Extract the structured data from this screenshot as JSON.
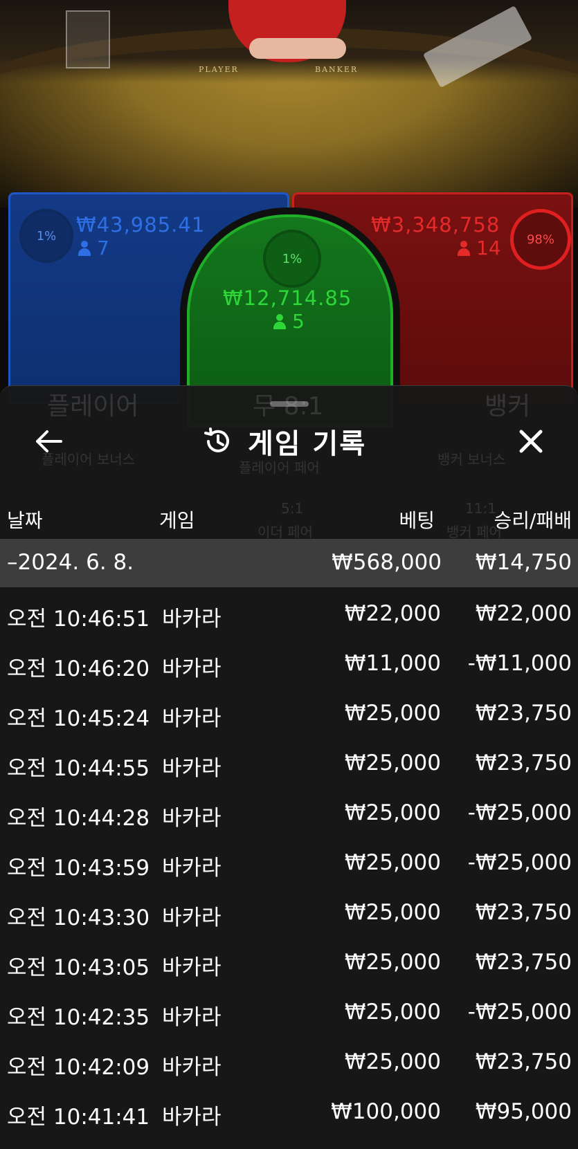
{
  "table_scene": {
    "player_word": "PLAYER",
    "banker_word": "BANKER"
  },
  "bets": {
    "player": {
      "percent": "1%",
      "amount": "₩43,985.41",
      "count": "7",
      "color": "#2f6fe6"
    },
    "tie": {
      "percent": "1%",
      "amount": "₩12,714.85",
      "count": "5",
      "color": "#2fd63a"
    },
    "banker": {
      "percent": "98%",
      "amount": "₩3,348,758",
      "count": "14",
      "color": "#e52a2a"
    }
  },
  "background_labels": {
    "player": "플레이어",
    "tie": "무 8:1",
    "banker": "뱅커",
    "player_bonus": "플레이어 보너스",
    "player_pair": "플레이어 페어",
    "banker_bonus": "뱅커 보너스",
    "either_pair_odds": "5:1",
    "either_pair": "이더 페어",
    "banker_pair_odds": "11:1",
    "banker_pair": "뱅커 페어"
  },
  "sheet": {
    "title": "게임 기록",
    "back_icon": "arrow-left-icon",
    "history_icon": "history-icon",
    "close_icon": "close-icon"
  },
  "columns": {
    "date": "날짜",
    "game": "게임",
    "bet": "베팅",
    "result": "승리/패배"
  },
  "group": {
    "date": "–2024. 6. 8.",
    "bet_total": "₩568,000",
    "result_total": "₩14,750"
  },
  "rows": [
    {
      "time": "오전 10:46:51",
      "game": "바카라",
      "bet": "₩22,000",
      "result": "₩22,000"
    },
    {
      "time": "오전 10:46:20",
      "game": "바카라",
      "bet": "₩11,000",
      "result": "-₩11,000"
    },
    {
      "time": "오전 10:45:24",
      "game": "바카라",
      "bet": "₩25,000",
      "result": "₩23,750"
    },
    {
      "time": "오전 10:44:55",
      "game": "바카라",
      "bet": "₩25,000",
      "result": "₩23,750"
    },
    {
      "time": "오전 10:44:28",
      "game": "바카라",
      "bet": "₩25,000",
      "result": "-₩25,000"
    },
    {
      "time": "오전 10:43:59",
      "game": "바카라",
      "bet": "₩25,000",
      "result": "-₩25,000"
    },
    {
      "time": "오전 10:43:30",
      "game": "바카라",
      "bet": "₩25,000",
      "result": "₩23,750"
    },
    {
      "time": "오전 10:43:05",
      "game": "바카라",
      "bet": "₩25,000",
      "result": "₩23,750"
    },
    {
      "time": "오전 10:42:35",
      "game": "바카라",
      "bet": "₩25,000",
      "result": "-₩25,000"
    },
    {
      "time": "오전 10:42:09",
      "game": "바카라",
      "bet": "₩25,000",
      "result": "₩23,750"
    },
    {
      "time": "오전 10:41:41",
      "game": "바카라",
      "bet": "₩100,000",
      "result": "₩95,000"
    }
  ]
}
